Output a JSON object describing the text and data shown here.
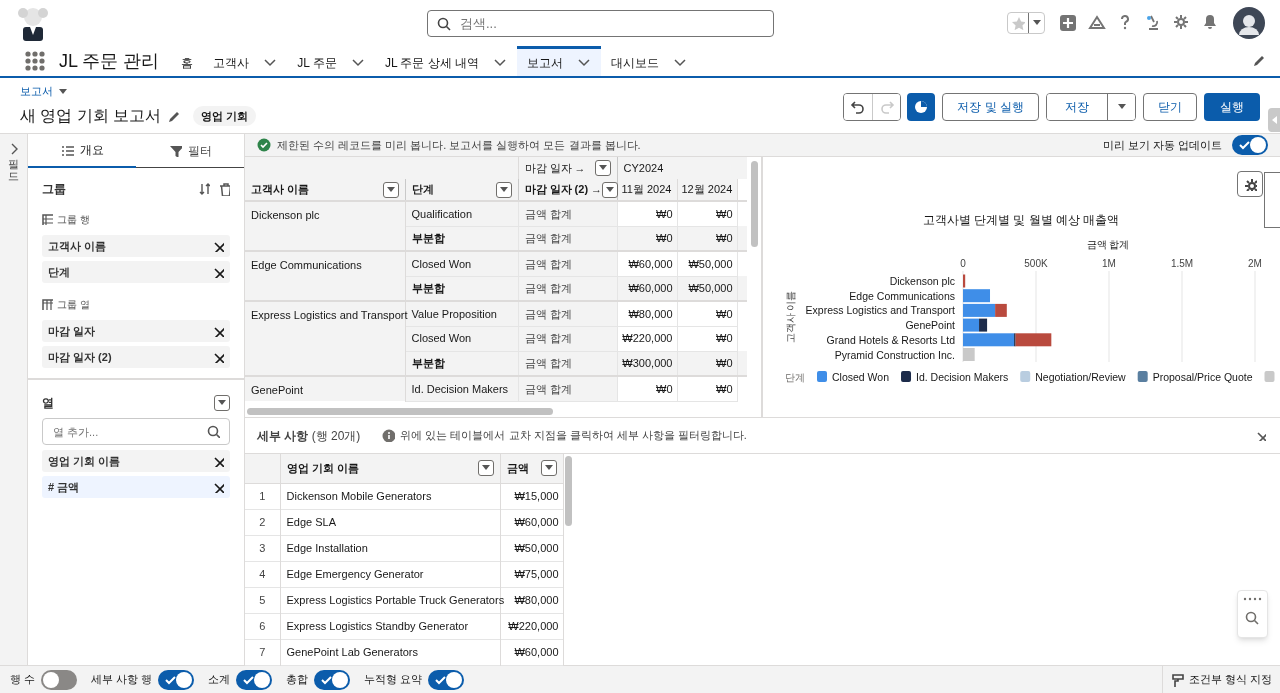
{
  "header": {
    "search": {
      "placeholder": "검색..."
    }
  },
  "nav": {
    "app_name": "JL 주문 관리",
    "tabs": [
      {
        "label": "홈",
        "has_menu": false,
        "selected": false
      },
      {
        "label": "고객사",
        "has_menu": true,
        "selected": false
      },
      {
        "label": "JL 주문",
        "has_menu": true,
        "selected": false
      },
      {
        "label": "JL 주문 상세 내역",
        "has_menu": true,
        "selected": false
      },
      {
        "label": "보고서",
        "has_menu": true,
        "selected": true
      },
      {
        "label": "대시보드",
        "has_menu": true,
        "selected": false
      }
    ]
  },
  "report_header": {
    "breadcrumb": "보고서",
    "title": "새 영업 기회 보고서",
    "report_type": "영업 기회",
    "history_buttons": [
      {
        "kind": "undo",
        "disabled": false
      },
      {
        "kind": "redo",
        "disabled": true
      }
    ],
    "chart_toggle": {
      "on": true
    },
    "buttons": [
      {
        "label": "저장 및 실행",
        "kind": "plain"
      },
      {
        "label": "저장",
        "kind": "split"
      },
      {
        "label": "닫기",
        "kind": "plain"
      },
      {
        "label": "실행",
        "kind": "primary"
      }
    ]
  },
  "fields_tab": {
    "label": "필드"
  },
  "outline_panel": {
    "tabs": [
      {
        "label": "개요",
        "kind": "outline",
        "selected": true
      },
      {
        "label": "필터",
        "kind": "filter",
        "selected": false
      }
    ],
    "groups": {
      "title": "그룹",
      "row_groups": {
        "title": "그룹 행",
        "items": [
          "고객사 이름",
          "단계"
        ]
      },
      "column_groups": {
        "title": "그룹 열",
        "items": [
          "마감 일자",
          "마감 일자 (2)"
        ]
      }
    },
    "columns": {
      "title": "열",
      "search_placeholder": "열 추가...",
      "items": [
        {
          "label": "영업 기회 이름",
          "selected": false
        },
        {
          "label": "# 금액",
          "selected": true
        }
      ]
    }
  },
  "preview_bar": {
    "message": "제한된 수의 레코드를 미리 봅니다. 보고서를 실행하여 모든 결과를 봅니다.",
    "auto_update": {
      "label": "미리 보기 자동 업데이트",
      "on": true
    }
  },
  "summary_table": {
    "column_group_label": "마감 일자 →",
    "year": "CY2024",
    "columns": [
      "고객사 이름",
      "단계",
      "마감 일자 (2) →",
      "11월 2024",
      "12월 2024"
    ],
    "rows": [
      {
        "customer": "Dickenson plc",
        "stage": "Qualification",
        "subtotal": false,
        "measure": "금액 합계",
        "values": [
          "₩0",
          "₩0"
        ]
      },
      {
        "stage": "부분합",
        "subtotal": true,
        "measure": "금액 합계",
        "values": [
          "₩0",
          "₩0"
        ]
      },
      {
        "customer": "Edge Communications",
        "stage": "Closed Won",
        "subtotal": false,
        "measure": "금액 합계",
        "values": [
          "₩60,000",
          "₩50,000"
        ]
      },
      {
        "stage": "부분합",
        "subtotal": true,
        "measure": "금액 합계",
        "values": [
          "₩60,000",
          "₩50,000"
        ]
      },
      {
        "customer": "Express Logistics and Transport",
        "stage": "Value Proposition",
        "subtotal": false,
        "measure": "금액 합계",
        "values": [
          "₩80,000",
          "₩0"
        ]
      },
      {
        "stage": "Closed Won",
        "subtotal": false,
        "measure": "금액 합계",
        "values": [
          "₩220,000",
          "₩0"
        ]
      },
      {
        "stage": "부분합",
        "subtotal": true,
        "measure": "금액 합계",
        "values": [
          "₩300,000",
          "₩0"
        ]
      },
      {
        "customer": "GenePoint",
        "stage": "Id. Decision Makers",
        "subtotal": false,
        "measure": "금액 합계",
        "values": [
          "₩0",
          "₩0"
        ]
      }
    ]
  },
  "chart": {
    "legend_title": "단계",
    "chart_data": {
      "type": "bar",
      "orientation": "horizontal",
      "stacked": true,
      "title": "고객사별 단계별 및 월별 예상 매출액",
      "xlabel": "금액 합계",
      "ylabel": "고객사 이름",
      "categories": [
        "Dickenson plc",
        "Edge Communications",
        "Express Logistics and Transport",
        "GenePoint",
        "Grand Hotels & Resorts Ltd",
        "Pyramid Construction Inc."
      ],
      "xlim": [
        0,
        2000000
      ],
      "grid": true,
      "legend": "bottom",
      "xticks": [
        0,
        {
          "value": 500000,
          "label": "500K"
        },
        {
          "value": 1000000,
          "label": "1M"
        },
        {
          "value": 1500000,
          "label": "1.5M"
        },
        {
          "value": 2000000,
          "label": "2M"
        }
      ],
      "series": [
        {
          "name": "Closed Won",
          "color": "#3f8ee8",
          "values": [
            null,
            185000,
            220000,
            110000,
            350000,
            null
          ]
        },
        {
          "name": "Id. Decision Makers",
          "color": "#1c2b4a",
          "values": [
            null,
            null,
            null,
            55000,
            10000,
            null
          ]
        },
        {
          "name": "Negotiation/Review",
          "color": "#b9cde0",
          "values": [
            null,
            null,
            null,
            null,
            null,
            null
          ]
        },
        {
          "name": "Proposal/Price Quote",
          "color": "#5a7fa0",
          "values": [
            null,
            null,
            null,
            null,
            null,
            null
          ]
        },
        {
          "color": "#c9c9c9",
          "values": [
            null,
            null,
            null,
            null,
            null,
            80000
          ]
        },
        {
          "color": "#b94a3e",
          "values": [
            15000,
            null,
            80000,
            null,
            245000,
            null
          ]
        }
      ]
    }
  },
  "detail": {
    "title": "**세부 사항** (행 20개)",
    "hint": "위에 있는 테이블에서 교차 지점을 클릭하여 세부 사항을 필터링합니다.",
    "columns": [
      "영업 기회 이름",
      "금액"
    ],
    "rows": [
      {
        "index": "1",
        "name": "Dickenson Mobile Generators",
        "amount": "₩15,000"
      },
      {
        "index": "2",
        "name": "Edge SLA",
        "amount": "₩60,000"
      },
      {
        "index": "3",
        "name": "Edge Installation",
        "amount": "₩50,000"
      },
      {
        "index": "4",
        "name": "Edge Emergency Generator",
        "amount": "₩75,000"
      },
      {
        "index": "5",
        "name": "Express Logistics Portable Truck Generators",
        "amount": "₩80,000"
      },
      {
        "index": "6",
        "name": "Express Logistics Standby Generator",
        "amount": "₩220,000"
      },
      {
        "index": "7",
        "name": "GenePoint Lab Generators",
        "amount": "₩60,000"
      }
    ]
  },
  "footer": {
    "toggles": [
      {
        "label": "행 수",
        "on": false
      },
      {
        "label": "세부 사항 행",
        "on": true
      },
      {
        "label": "소계",
        "on": true
      },
      {
        "label": "총합",
        "on": true
      },
      {
        "label": "누적형 요약",
        "on": true
      }
    ],
    "conditional_format": "조건부 형식 지정"
  }
}
